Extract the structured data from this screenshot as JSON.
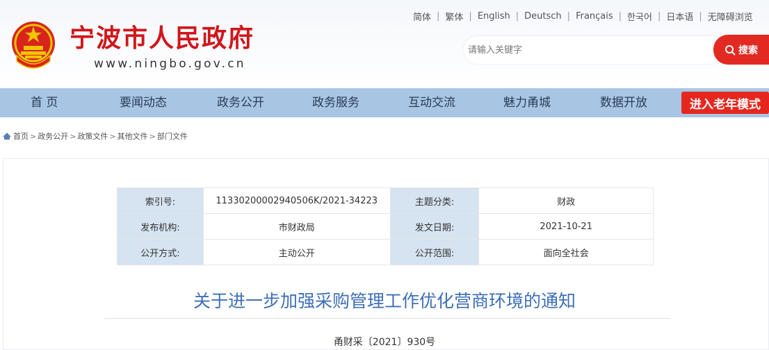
{
  "header": {
    "site_title": "宁波市人民政府",
    "site_url": "www.ningbo.gov.cn",
    "languages": [
      "简体",
      "繁体",
      "English",
      "Deutsch",
      "Français",
      "한국어",
      "日本语",
      "无障碍浏览"
    ],
    "search_placeholder": "请输入关键字",
    "search_button": "搜索"
  },
  "nav": {
    "items": [
      "首  页",
      "要闻动态",
      "政务公开",
      "政务服务",
      "互动交流",
      "魅力甬城",
      "数据开放"
    ],
    "senior_mode": "进入老年模式"
  },
  "breadcrumb": [
    "首页",
    "政务公开",
    "政策文件",
    "其他文件",
    "部门文件"
  ],
  "meta": {
    "rows": [
      {
        "label1": "索引号:",
        "value1": "11330200002940506K/2021-34223",
        "label2": "主题分类:",
        "value2": "财政"
      },
      {
        "label1": "发布机构:",
        "value1": "市财政局",
        "label2": "发文日期:",
        "value2": "2021-10-21"
      },
      {
        "label1": "公开方式:",
        "value1": "主动公开",
        "label2": "公开范围:",
        "value2": "面向全社会"
      }
    ]
  },
  "document": {
    "title": "关于进一步加强采购管理工作优化营商环境的通知",
    "number": "甬财采〔2021〕930号"
  },
  "colors": {
    "brand_red": "#d0161b",
    "nav_bg": "#a8c6e4",
    "title_blue": "#3d6fb8",
    "label_bg": "#d6e3f0"
  }
}
